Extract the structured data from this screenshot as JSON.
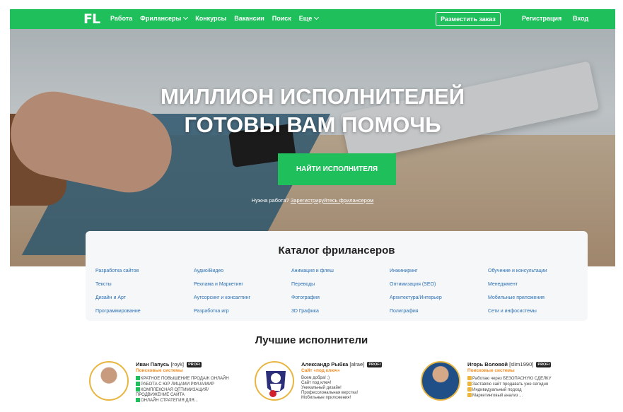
{
  "nav": {
    "logo": "FL",
    "links": [
      "Работа",
      "Фрилансеры",
      "Конкурсы",
      "Вакансии",
      "Поиск",
      "Еще"
    ],
    "order_button": "Разместить заказ",
    "register": "Регистрация",
    "login": "Вход",
    "color": "#1fbf5b"
  },
  "hero": {
    "title_line1": "МИЛЛИОН ИСПОЛНИТЕЛЕЙ",
    "title_line2": "ГОТОВЫ ВАМ ПОМОЧЬ",
    "button": "НАЙТИ ИСПОЛНИТЕЛЯ",
    "sub_text": "Нужна работа?",
    "sub_link": "Зарегистрируйтесь фрилансером"
  },
  "catalog": {
    "title": "Каталог фрилансеров",
    "columns": [
      [
        "Разработка сайтов",
        "Тексты",
        "Дизайн и Арт",
        "Программирование"
      ],
      [
        "Аудио/Видео",
        "Реклама и Маркетинг",
        "Аутсорсинг и консалтинг",
        "Разработка игр"
      ],
      [
        "Анимация и флеш",
        "Переводы",
        "Фотография",
        "3D Графика"
      ],
      [
        "Инжиниринг",
        "Оптимизация (SEO)",
        "Архитектура/Интерьер",
        "Полиграфия"
      ],
      [
        "Обучение и консультации",
        "Менеджмент",
        "Мобильные приложения",
        "Сети и инфосистемы"
      ]
    ]
  },
  "best": {
    "title": "Лучшие исполнители",
    "freelancers": [
      {
        "name": "Иван Папусь",
        "login": "[royk]",
        "badge": "PROFI",
        "category": "Поисковые системы",
        "lines": [
          "КРАТНОЕ ПОВЫШЕНИЕ ПРОДАЖ ОНЛАЙН",
          "РАБОТА С ЮР ЛИЦАМИ РФ/UA/МИР",
          "КОМПЛЕКСНАЯ ОПТИМИЗАЦИЯ/",
          "ПРОДВИЖЕНИЕ САЙТА",
          "ОНЛАЙН СТРАТЕГИЯ ДЛЯ..."
        ]
      },
      {
        "name": "Александр Рыбка",
        "login": "[alrae]",
        "badge": "PROFI",
        "category": "Сайт «под ключ»",
        "lines": [
          "Всем добра! ;)",
          "Сайт под ключ!",
          "Уникальный дизайн!",
          "Профессиональная верстка!",
          "Мобильные приложения!"
        ]
      },
      {
        "name": "Игорь Воловой",
        "login": "[slim1990]",
        "badge": "PROFI",
        "category": "Поисковые системы",
        "lines": [
          "Работаю через БЕЗОПАСНУЮ СДЕЛКУ",
          "Заставлю сайт продавать уже сегодня",
          "Индивидуальный подход",
          "Маркетинговый анализ ..."
        ]
      }
    ]
  }
}
